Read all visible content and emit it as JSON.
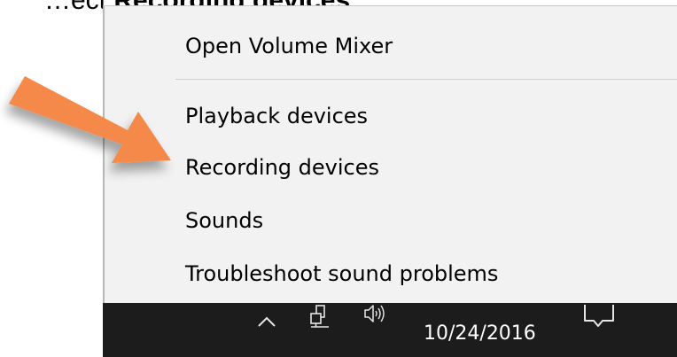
{
  "caption": {
    "prefix": "…ect ",
    "bold": "Recording devices",
    "suffix": "."
  },
  "context_menu": {
    "open_volume_mixer": "Open Volume Mixer",
    "playback_devices": "Playback devices",
    "recording_devices": "Recording devices",
    "sounds": "Sounds",
    "troubleshoot": "Troubleshoot sound problems"
  },
  "taskbar": {
    "date": "10/24/2016",
    "icons": [
      "chevron-up-icon",
      "network-icon",
      "volume-icon",
      "notification-icon"
    ]
  },
  "annotation": {
    "arrow_color": "#f4894a",
    "points_to": "Recording devices"
  }
}
